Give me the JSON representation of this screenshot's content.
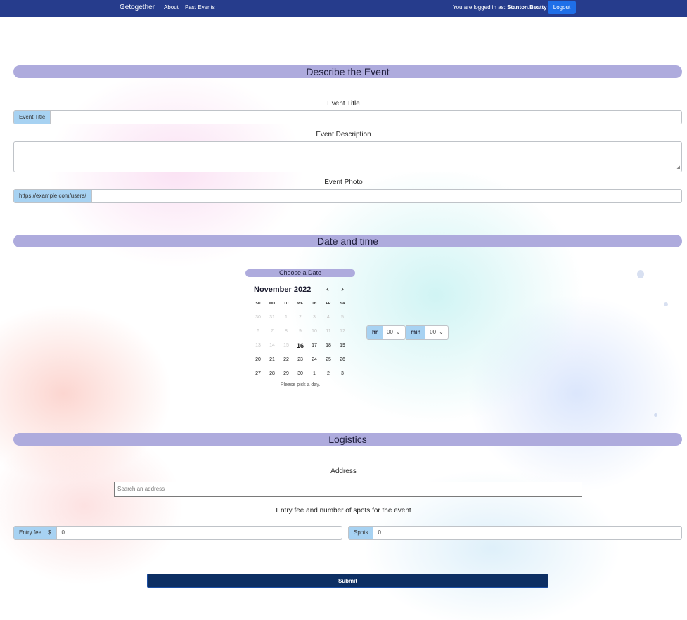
{
  "navbar": {
    "brand": "Getogether",
    "links": [
      "About",
      "Past Events"
    ],
    "login_prefix": "You are logged in as:",
    "username": "Stanton.Beatty",
    "separator": "|",
    "logout_label": "Logout"
  },
  "describe": {
    "heading": "Describe the Event",
    "title_label": "Event Title",
    "title_addon": "Event Title",
    "title_value": "",
    "description_label": "Event Description",
    "description_value": "",
    "photo_label": "Event Photo",
    "photo_addon": "https://example.com/users/",
    "photo_value": ""
  },
  "datetime": {
    "heading": "Date and time",
    "choose_label": "Choose a Date",
    "month_title": "November 2022",
    "prev_icon": "chevron-left-icon",
    "next_icon": "chevron-right-icon",
    "weekdays": [
      "SU",
      "MO",
      "TU",
      "WE",
      "TH",
      "FR",
      "SA"
    ],
    "weeks": [
      [
        "30",
        "31",
        "1",
        "2",
        "3",
        "4",
        "5"
      ],
      [
        "6",
        "7",
        "8",
        "9",
        "10",
        "11",
        "12"
      ],
      [
        "13",
        "14",
        "15",
        "16",
        "17",
        "18",
        "19"
      ],
      [
        "20",
        "21",
        "22",
        "23",
        "24",
        "25",
        "26"
      ],
      [
        "27",
        "28",
        "29",
        "30",
        "1",
        "2",
        "3"
      ]
    ],
    "today": "16",
    "hint": "Please pick a day.",
    "hour_label": "hr",
    "hour_value": "00",
    "minute_label": "min",
    "minute_value": "00"
  },
  "logistics": {
    "heading": "Logistics",
    "address_label": "Address",
    "address_placeholder": "Search an address",
    "fee_label": "Entry fee and number of spots for the event",
    "fee_addon": "Entry fee",
    "currency": "$",
    "fee_value": "0",
    "spots_addon": "Spots",
    "spots_value": "0"
  },
  "submit_label": "Submit"
}
